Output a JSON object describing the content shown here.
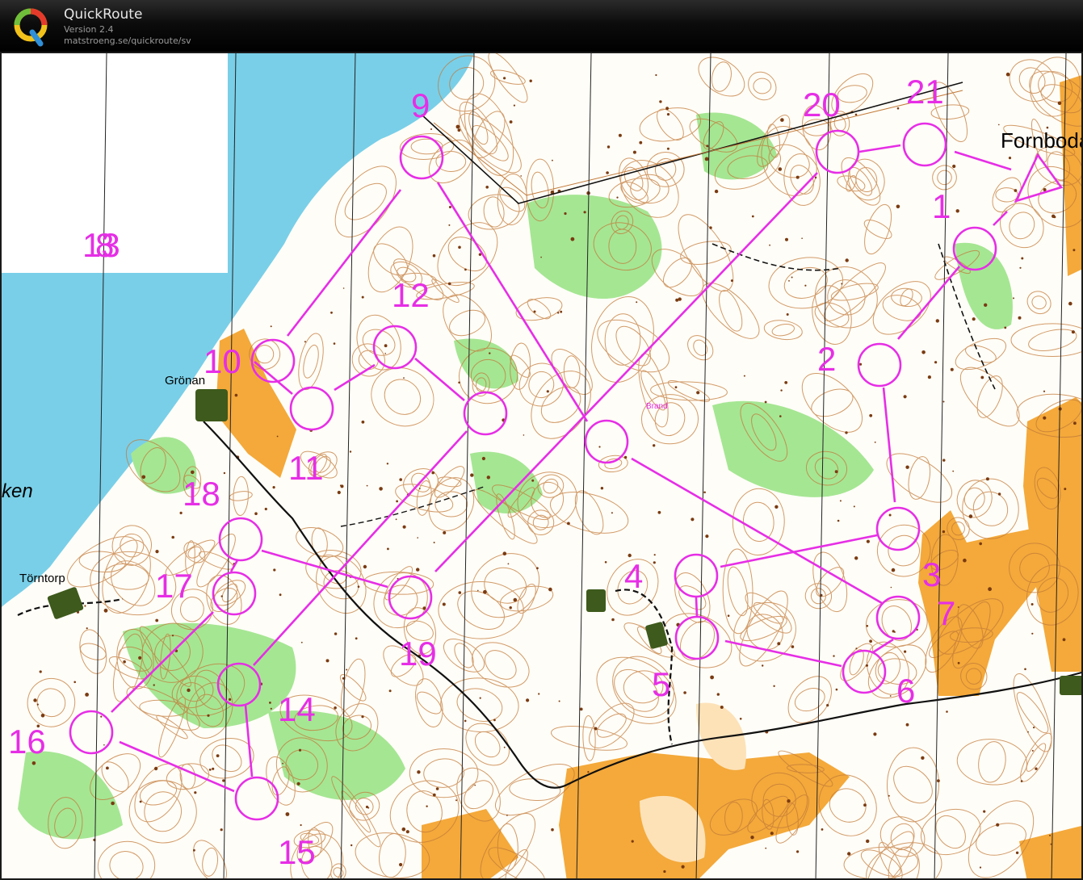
{
  "app": {
    "name": "QuickRoute",
    "version": "Version 2.4",
    "url": "matstroeng.se/quickroute/sv",
    "logo_letter": "Q"
  },
  "colors": {
    "course": "#e62ee6",
    "water": "#79cfe8",
    "open_land": "#f4a93a",
    "vegetation": "#9be38a",
    "forest": "#ffffff",
    "contour": "#c27a3a"
  },
  "map": {
    "place_names": {
      "fornboda": "Fornboda",
      "gronan": "Grönan",
      "torntorp": "Törntorp",
      "lake_fragment": "ken",
      "brand": "Brand"
    },
    "controls": [
      {
        "label": "1"
      },
      {
        "label": "2"
      },
      {
        "label": "3"
      },
      {
        "label": "4"
      },
      {
        "label": "5"
      },
      {
        "label": "6"
      },
      {
        "label": "7"
      },
      {
        "label": "8"
      },
      {
        "label": "9"
      },
      {
        "label": "10"
      },
      {
        "label": "11"
      },
      {
        "label": "12"
      },
      {
        "label": "13"
      },
      {
        "label": "14"
      },
      {
        "label": "15"
      },
      {
        "label": "16"
      },
      {
        "label": "17"
      },
      {
        "label": "18"
      },
      {
        "label": "19"
      },
      {
        "label": "20"
      },
      {
        "label": "21"
      }
    ],
    "overlap_label": "18"
  }
}
